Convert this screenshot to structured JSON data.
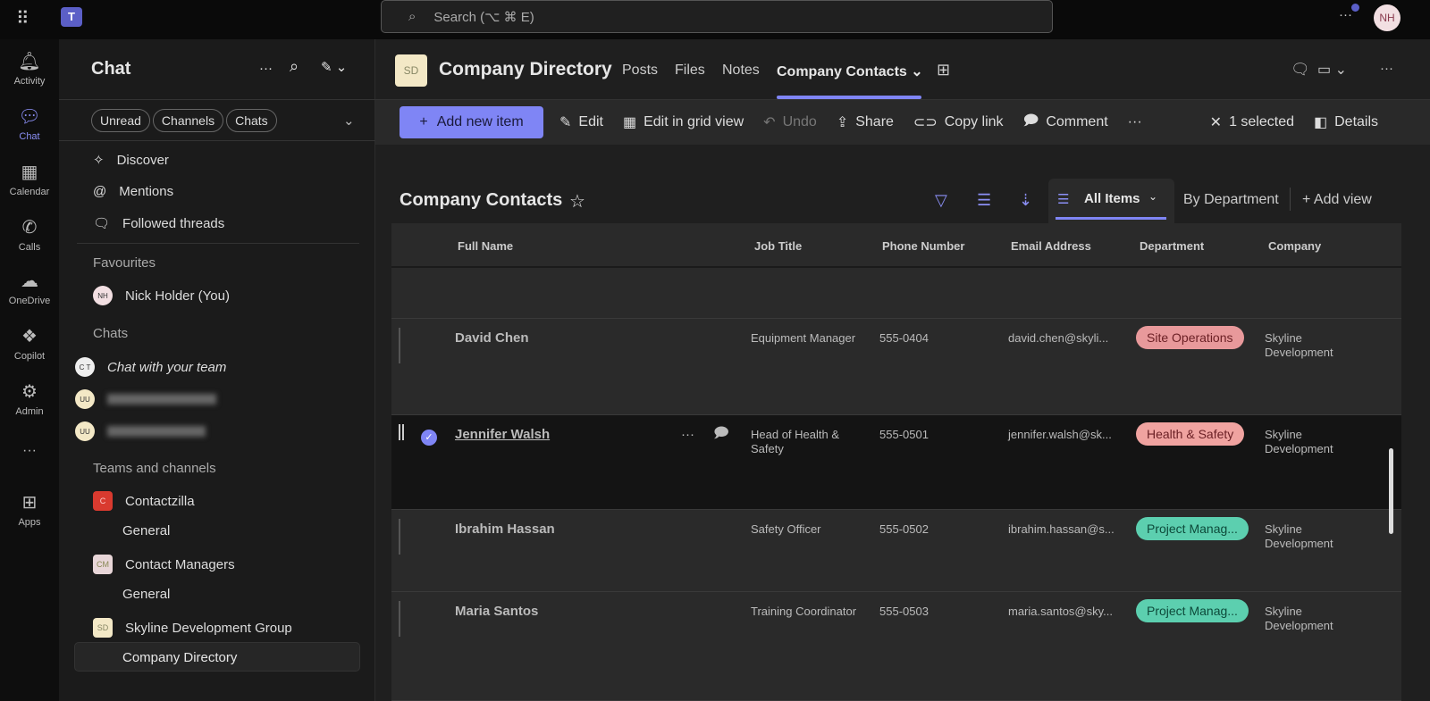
{
  "search": {
    "placeholder": "Search (⌥ ⌘ E)"
  },
  "user": {
    "initials": "NH"
  },
  "rail": [
    {
      "label": "Activity",
      "icon": "bell-icon"
    },
    {
      "label": "Chat",
      "icon": "chat-icon"
    },
    {
      "label": "Calendar",
      "icon": "calendar-icon"
    },
    {
      "label": "Calls",
      "icon": "phone-icon"
    },
    {
      "label": "OneDrive",
      "icon": "cloud-icon"
    },
    {
      "label": "Copilot",
      "icon": "copilot-icon"
    },
    {
      "label": "Admin",
      "icon": "admin-icon"
    },
    {
      "label": "Apps",
      "icon": "plus-square-icon"
    }
  ],
  "chat": {
    "title": "Chat",
    "filters": [
      "Unread",
      "Channels",
      "Chats"
    ],
    "quick": [
      "Discover",
      "Mentions",
      "Followed threads"
    ],
    "favourites_label": "Favourites",
    "fav": {
      "initials": "NH",
      "name": "Nick Holder (You)"
    },
    "chats_label": "Chats",
    "chat_items": [
      {
        "initials": "C T",
        "name": "Chat with your team"
      },
      {
        "initials": "UU"
      },
      {
        "initials": "UU"
      }
    ],
    "teams_label": "Teams and channels",
    "teams": [
      {
        "initials": "C",
        "name": "Contactzilla",
        "channel": "General",
        "color": "#d93a2f"
      },
      {
        "initials": "CM",
        "name": "Contact Managers",
        "channel": "General",
        "color": "#e8d6d8"
      },
      {
        "initials": "SD",
        "name": "Skyline Development Group",
        "channel": "Company Directory",
        "color": "#f3e8c6"
      }
    ]
  },
  "header": {
    "initials": "SD",
    "title": "Company Directory",
    "tabs": [
      "Posts",
      "Files",
      "Notes",
      "Company Contacts"
    ]
  },
  "toolbar": {
    "add": "Add new item",
    "edit": "Edit",
    "grid": "Edit in grid view",
    "undo": "Undo",
    "share": "Share",
    "copy": "Copy link",
    "comment": "Comment",
    "selected": "1 selected",
    "details": "Details"
  },
  "list": {
    "title": "Company Contacts",
    "views": {
      "all": "All Items",
      "dept": "By Department",
      "add": "Add view"
    },
    "columns": [
      "Full Name",
      "Job Title",
      "Phone Number",
      "Email Address",
      "Department",
      "Company"
    ],
    "rows": [
      {
        "name": "David Chen",
        "title": "Equipment Manager",
        "phone": "555-0404",
        "email": "david.chen@skyli...",
        "dept": "Site Operations",
        "dept_color": "#e8999b",
        "company": "Skyline Development"
      },
      {
        "name": "Jennifer Walsh",
        "title": "Head of Health & Safety",
        "phone": "555-0501",
        "email": "jennifer.walsh@sk...",
        "dept": "Health & Safety",
        "dept_color": "#f0a3a0",
        "company": "Skyline Development"
      },
      {
        "name": "Ibrahim Hassan",
        "title": "Safety Officer",
        "phone": "555-0502",
        "email": "ibrahim.hassan@s...",
        "dept": "Project Manag...",
        "dept_color": "#5ccfaf",
        "company": "Skyline Development"
      },
      {
        "name": "Maria Santos",
        "title": "Training Coordinator",
        "phone": "555-0503",
        "email": "maria.santos@sky...",
        "dept": "Project Manag...",
        "dept_color": "#5ccfaf",
        "company": "Skyline Development"
      }
    ]
  },
  "colors": {
    "accent": "#7f85f5"
  }
}
